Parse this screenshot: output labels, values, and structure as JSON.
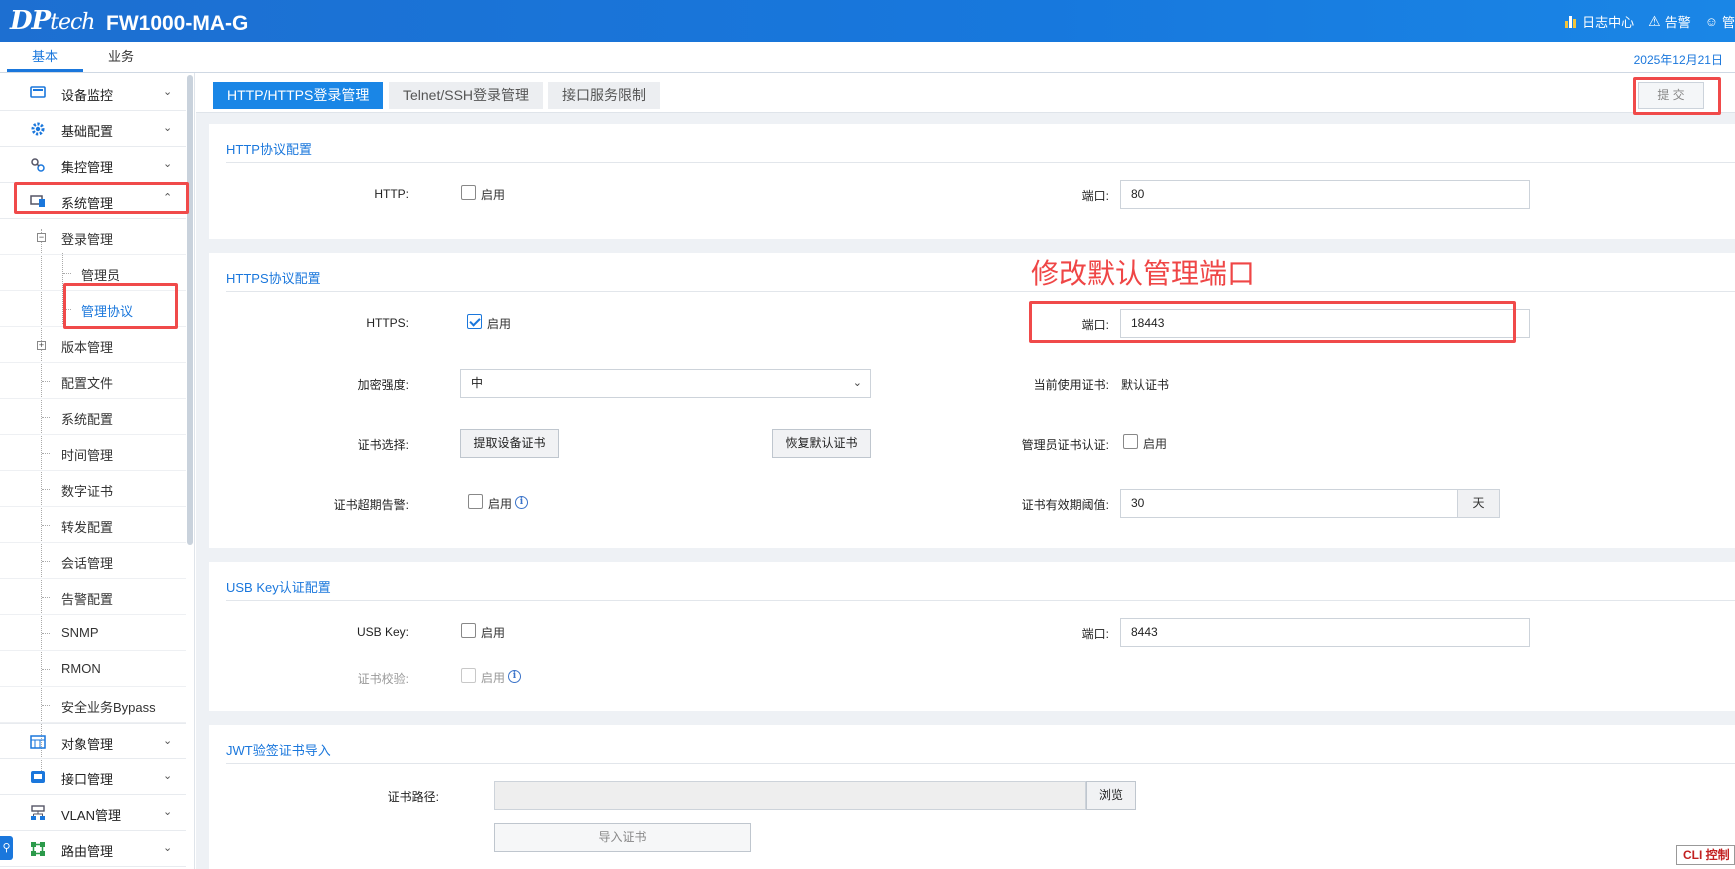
{
  "header": {
    "logo": "DPtech",
    "model": "FW1000-MA-G",
    "log_center": "日志中心",
    "alarm": "告警",
    "user": "管"
  },
  "main_tabs": [
    {
      "label": "基本",
      "active": true
    },
    {
      "label": "业务",
      "active": false
    }
  ],
  "date": "2025年12月21日",
  "sidebar": {
    "groups": [
      {
        "label": "设备监控",
        "icon": "monitor-icon"
      },
      {
        "label": "基础配置",
        "icon": "gear-icon"
      },
      {
        "label": "集控管理",
        "icon": "cluster-icon"
      },
      {
        "label": "系统管理",
        "icon": "system-icon",
        "expanded": true
      }
    ],
    "login_mgmt": "登录管理",
    "admin": "管理员",
    "mgmt_protocol": "管理协议",
    "version_mgmt": "版本管理",
    "items": [
      "配置文件",
      "系统配置",
      "时间管理",
      "数字证书",
      "转发配置",
      "会话管理",
      "告警配置",
      "SNMP",
      "RMON",
      "安全业务Bypass"
    ],
    "bottom_groups": [
      {
        "label": "对象管理",
        "icon": "object-icon"
      },
      {
        "label": "接口管理",
        "icon": "interface-icon"
      },
      {
        "label": "VLAN管理",
        "icon": "vlan-icon"
      },
      {
        "label": "路由管理",
        "icon": "route-icon"
      }
    ]
  },
  "tabs": [
    {
      "label": "HTTP/HTTPS登录管理",
      "active": true
    },
    {
      "label": "Telnet/SSH登录管理",
      "active": false
    },
    {
      "label": "接口服务限制",
      "active": false
    }
  ],
  "submit_label": "提 交",
  "http": {
    "title": "HTTP协议配置",
    "label": "HTTP:",
    "enable_label": "启用",
    "enabled": false,
    "port_label": "端口:",
    "port": "80"
  },
  "https": {
    "title": "HTTPS协议配置",
    "label": "HTTPS:",
    "enable_label": "启用",
    "enabled": true,
    "port_label": "端口:",
    "port": "18443",
    "cipher_label": "加密强度:",
    "cipher_value": "中",
    "current_cert_label": "当前使用证书:",
    "current_cert_value": "默认证书",
    "cert_select_label": "证书选择:",
    "fetch_cert_button": "提取设备证书",
    "restore_cert_button": "恢复默认证书",
    "admin_cert_auth_label": "管理员证书认证:",
    "admin_cert_auth_enable": "启用",
    "cert_expire_alarm_label": "证书超期告警:",
    "cert_expire_alarm_enable": "启用",
    "cert_validity_label": "证书有效期阈值:",
    "cert_validity_value": "30",
    "cert_validity_unit": "天"
  },
  "usbkey": {
    "title": "USB Key认证配置",
    "label": "USB Key:",
    "enable_label": "启用",
    "port_label": "端口:",
    "port": "8443",
    "cert_check_label": "证书校验:",
    "cert_check_enable": "启用"
  },
  "jwt": {
    "title": "JWT验签证书导入",
    "cert_path_label": "证书路径:",
    "cert_path_value": "",
    "browse_button": "浏览",
    "import_button": "导入证书"
  },
  "annotation": "修改默认管理端口",
  "cli_label": "CLI 控制",
  "colors": {
    "brand_blue": "#1a77dc",
    "highlight_red": "#f04a4a"
  }
}
